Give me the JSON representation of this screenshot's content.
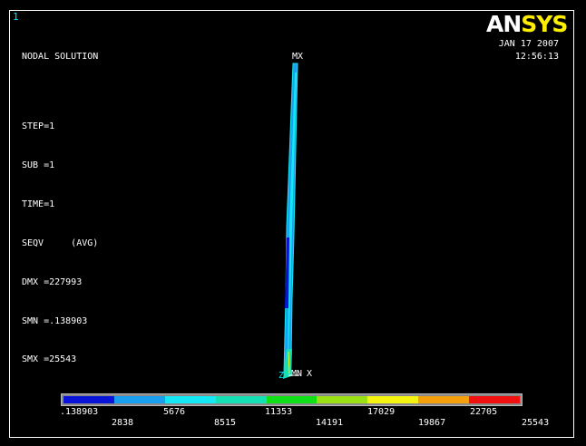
{
  "window_number": "1",
  "info_lines": [
    "NODAL SOLUTION",
    "",
    "STEP=1",
    "SUB =1",
    "TIME=1",
    "SEQV     (AVG)",
    "DMX =227993",
    "SMN =.138903",
    "SMX =25543"
  ],
  "logo": {
    "prefix": "AN",
    "suffix": "SYS"
  },
  "date": "JAN 17 2007",
  "time": "12:56:13",
  "markers": {
    "max": "MX",
    "min": "MN",
    "x_axis": "X",
    "z_axis": "Z"
  },
  "legend": {
    "colors": [
      "#0a14d8",
      "#1a9ff0",
      "#14e8f4",
      "#14e0b4",
      "#10e018",
      "#9ae014",
      "#f4f410",
      "#f4a00c",
      "#f01010"
    ],
    "labels_lower": [
      ".138903",
      "5676",
      "11353",
      "17029",
      "22705"
    ],
    "labels_upper": [
      "2838",
      "8515",
      "14191",
      "19867",
      "25543"
    ]
  }
}
